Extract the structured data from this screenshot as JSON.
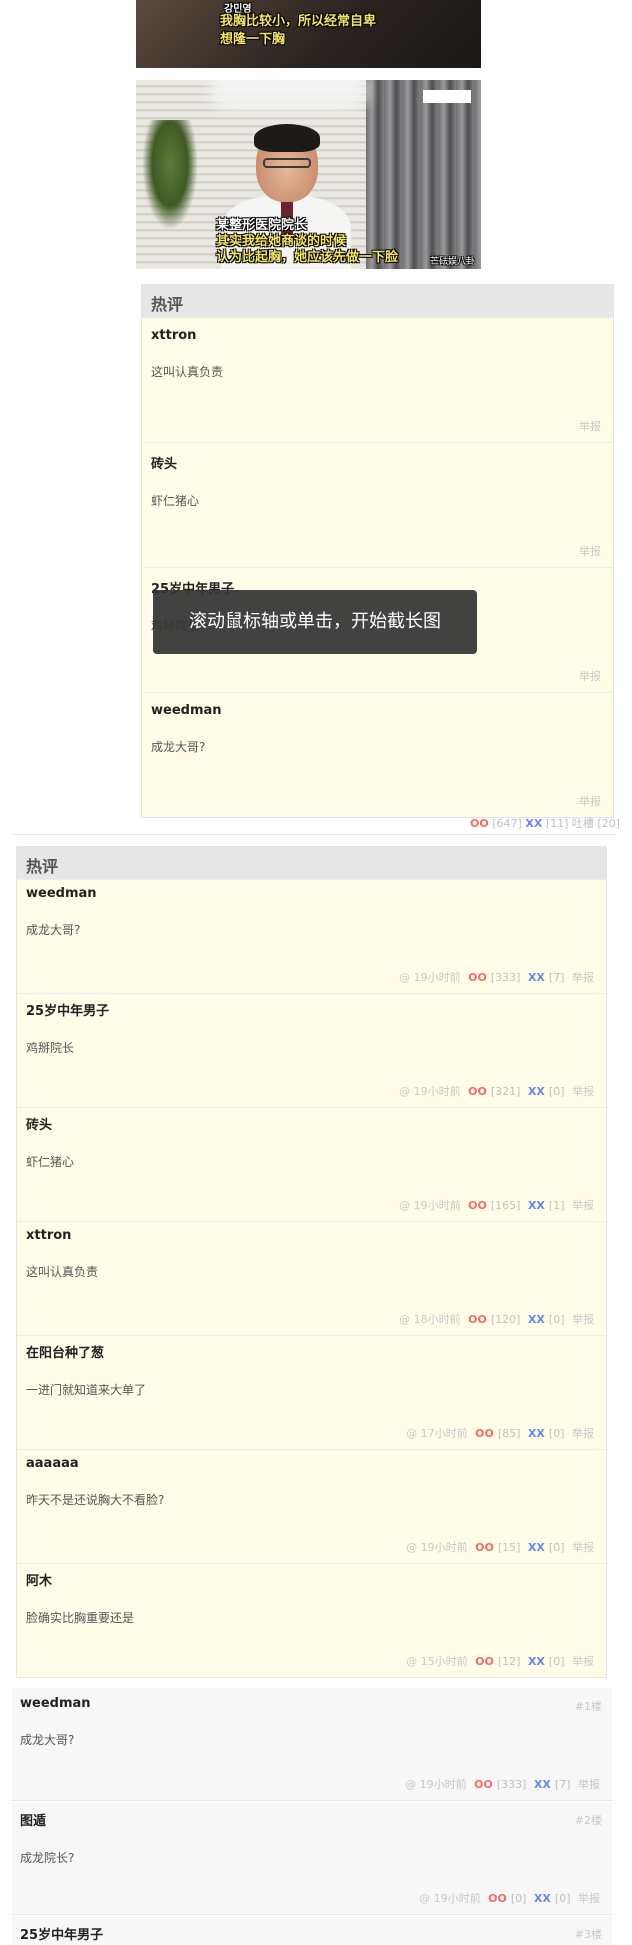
{
  "images": {
    "top": {
      "caption_small": "강민영",
      "caption_line1": "我胸比较小，所以经常自卑",
      "caption_line2": "想隆一下胸"
    },
    "doctor": {
      "caption_line1": "某整形医院院长",
      "caption_line2": "其实我给她商谈的时候",
      "caption_line3": "认为比起胸，她应该先做一下脸",
      "watermark": "芒砝娱八卦"
    }
  },
  "hot1": {
    "title": "热评",
    "comments": [
      {
        "author": "xttron",
        "text": "这叫认真负责",
        "report": "举报"
      },
      {
        "author": "砖头",
        "text": "虾仁猪心",
        "report": "举报"
      },
      {
        "author": "25岁中年男子",
        "text": "鸡掰院长",
        "report": "举报"
      },
      {
        "author": "weedman",
        "text": "成龙大哥?",
        "report": "举报"
      }
    ]
  },
  "post_votes": {
    "oo": "OO",
    "oo_count": "[647]",
    "xx": "XX",
    "xx_count": "[11]",
    "tucao": "吐槽",
    "tucao_count": "[20]"
  },
  "toast": {
    "text": "滚动鼠标轴或单击，开始截长图"
  },
  "hot2": {
    "title": "热评",
    "comments": [
      {
        "author": "weedman",
        "text": "成龙大哥?",
        "time": "@ 19小时前",
        "oo": "OO",
        "oo_count": "[333]",
        "xx": "XX",
        "xx_count": "[7]",
        "report": "举报"
      },
      {
        "author": "25岁中年男子",
        "text": "鸡掰院长",
        "time": "@ 19小时前",
        "oo": "OO",
        "oo_count": "[321]",
        "xx": "XX",
        "xx_count": "[0]",
        "report": "举报"
      },
      {
        "author": "砖头",
        "text": "虾仁猪心",
        "time": "@ 19小时前",
        "oo": "OO",
        "oo_count": "[165]",
        "xx": "XX",
        "xx_count": "[1]",
        "report": "举报"
      },
      {
        "author": "xttron",
        "text": "这叫认真负责",
        "time": "@ 18小时前",
        "oo": "OO",
        "oo_count": "[120]",
        "xx": "XX",
        "xx_count": "[0]",
        "report": "举报"
      },
      {
        "author": "在阳台种了葱",
        "text": "一进门就知道来大单了",
        "time": "@ 17小时前",
        "oo": "OO",
        "oo_count": "[85]",
        "xx": "XX",
        "xx_count": "[0]",
        "report": "举报"
      },
      {
        "author": "aaaaaa",
        "text": "昨天不是还说胸大不看脸?",
        "time": "@ 19小时前",
        "oo": "OO",
        "oo_count": "[15]",
        "xx": "XX",
        "xx_count": "[0]",
        "report": "举报"
      },
      {
        "author": "阿木",
        "text": "脸确实比胸重要还是",
        "time": "@ 15小时前",
        "oo": "OO",
        "oo_count": "[12]",
        "xx": "XX",
        "xx_count": "[0]",
        "report": "举报"
      }
    ]
  },
  "floors": [
    {
      "author": "weedman",
      "num": "#1楼",
      "text": "成龙大哥?",
      "time": "@ 19小时前",
      "oo": "OO",
      "oo_count": "[333]",
      "xx": "XX",
      "xx_count": "[7]",
      "report": "举报"
    },
    {
      "author": "图遁",
      "num": "#2楼",
      "text": "成龙院长?",
      "time": "@ 19小时前",
      "oo": "OO",
      "oo_count": "[0]",
      "xx": "XX",
      "xx_count": "[0]",
      "report": "举报"
    },
    {
      "author": "25岁中年男子",
      "num": "#3楼"
    }
  ]
}
